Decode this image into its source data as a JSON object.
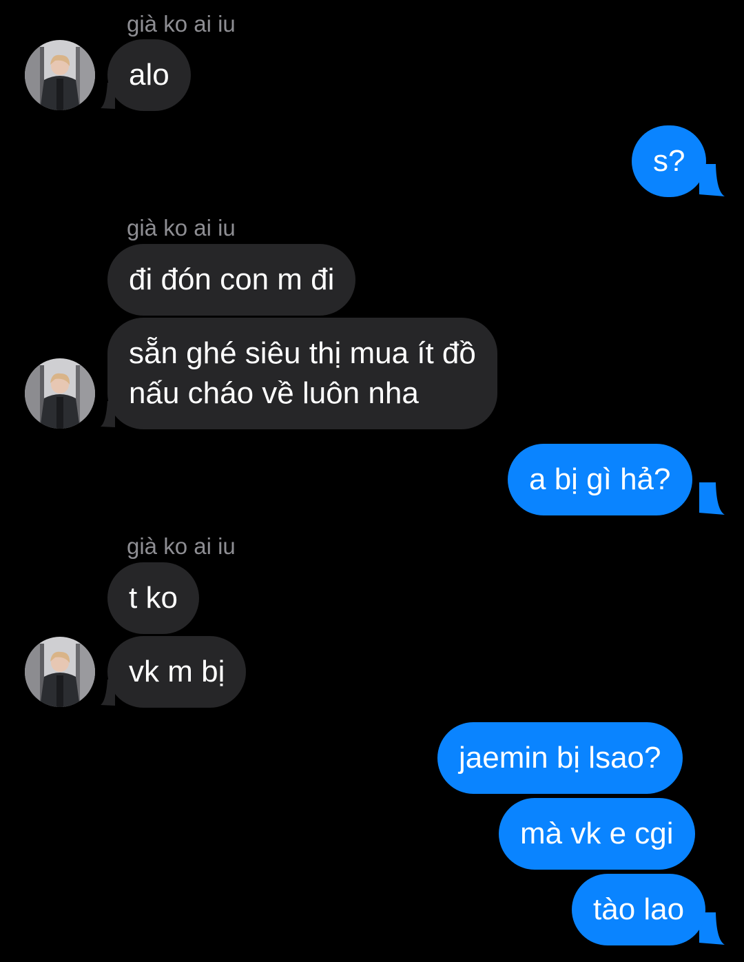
{
  "conversation": {
    "contact_label": "già ko ai iu",
    "colors": {
      "background": "#000000",
      "incoming_bubble": "#262628",
      "outgoing_bubble": "#0a84ff",
      "sender_name": "#8e8e93",
      "text": "#ffffff"
    },
    "avatar_icon": "contact-avatar-photo-icon",
    "messages": [
      {
        "id": "m1",
        "direction": "incoming",
        "text": "alo"
      },
      {
        "id": "m2",
        "direction": "outgoing",
        "text": "s?"
      },
      {
        "id": "m3",
        "direction": "incoming",
        "text": "đi đón con m đi"
      },
      {
        "id": "m4",
        "direction": "incoming",
        "lines": [
          "sẵn ghé siêu thị mua ít đồ",
          "nấu cháo về luôn nha"
        ]
      },
      {
        "id": "m5",
        "direction": "outgoing",
        "text": "a bị gì hả?"
      },
      {
        "id": "m6",
        "direction": "incoming",
        "text": "t ko"
      },
      {
        "id": "m7",
        "direction": "incoming",
        "text": "vk m bị"
      },
      {
        "id": "m8",
        "direction": "outgoing",
        "text": "jaemin bị lsao?"
      },
      {
        "id": "m9",
        "direction": "outgoing",
        "text": "mà vk e cgi"
      },
      {
        "id": "m10",
        "direction": "outgoing",
        "text": "tào lao"
      }
    ]
  }
}
